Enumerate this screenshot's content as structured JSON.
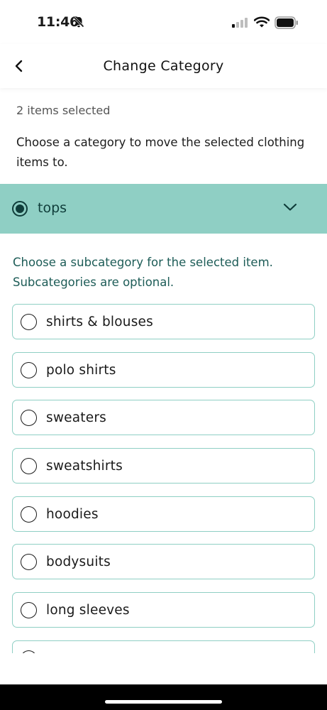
{
  "status": {
    "time": "11:46"
  },
  "nav": {
    "title": "Change Category"
  },
  "selection": {
    "count_text": "2 items selected"
  },
  "instruction": "Choose a category to move the selected clothing items to.",
  "category": {
    "label": "tops",
    "selected": true
  },
  "sub_instruction": "Choose a subcategory for the selected item. Subcategories are optional.",
  "subcategories": [
    {
      "label": "shirts & blouses"
    },
    {
      "label": "polo shirts"
    },
    {
      "label": "sweaters"
    },
    {
      "label": "sweatshirts"
    },
    {
      "label": "hoodies"
    },
    {
      "label": "bodysuits"
    },
    {
      "label": "long sleeves"
    },
    {
      "label": ""
    }
  ],
  "colors": {
    "accent": "#8fcfc4",
    "dark_teal": "#0f3d3a",
    "teal_text": "#1d5c57"
  }
}
